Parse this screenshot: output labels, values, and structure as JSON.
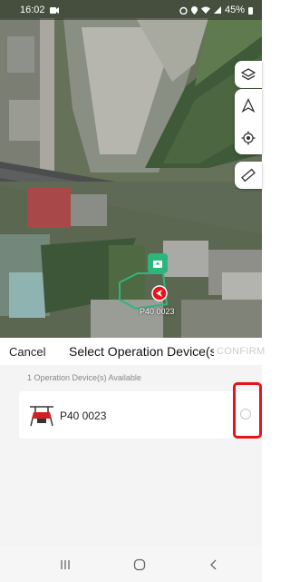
{
  "status_bar": {
    "time": "16:02",
    "battery": "45%",
    "icons": [
      "video-icon",
      "alarm-icon",
      "location-icon",
      "wifi-icon",
      "signal-icon",
      "battery-icon"
    ]
  },
  "map": {
    "controls": [
      "layers-icon",
      "navigation-arrow-icon",
      "my-location-icon",
      "ruler-icon"
    ],
    "marker_label": "P40 0023",
    "accent_color": "#2db67c",
    "marker_color": "#e8121c"
  },
  "sheet": {
    "cancel_label": "Cancel",
    "title": "Select Operation Device(s)",
    "confirm_label": "CONFIRM",
    "available_text": "1 Operation Device(s) Available",
    "devices": [
      {
        "name": "P40 0023",
        "icon": "drone-icon",
        "selected": false
      }
    ]
  },
  "nav_bar": {
    "buttons": [
      "recent-apps-icon",
      "home-icon",
      "back-icon"
    ]
  },
  "colors": {
    "highlight": "#e8121c",
    "confirm_disabled": "#cccccc"
  }
}
